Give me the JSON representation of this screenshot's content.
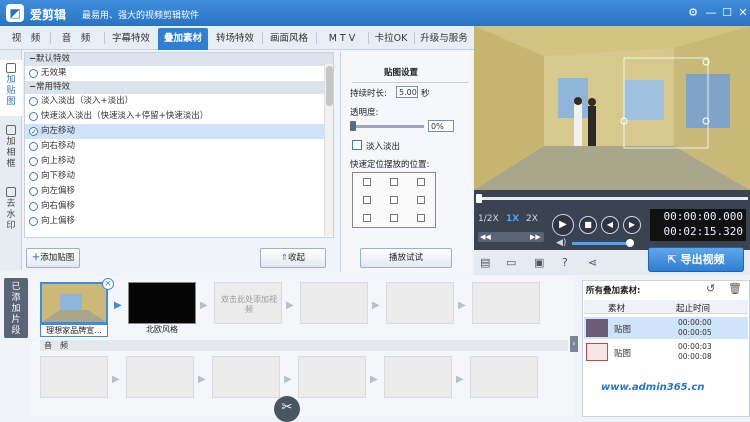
{
  "app": {
    "title": "爱剪辑",
    "slogan": "最易用、强大的视频剪辑软件",
    "window_buttons": [
      "settings-icon",
      "minimize-icon",
      "maximize-icon",
      "close-icon"
    ]
  },
  "tabs": [
    {
      "label": "视　频"
    },
    {
      "label": "音　频"
    },
    {
      "label": "字幕特效"
    },
    {
      "label": "叠加素材",
      "active": true
    },
    {
      "label": "转场特效"
    },
    {
      "label": "画面风格"
    },
    {
      "label": "M T V"
    },
    {
      "label": "卡拉OK"
    },
    {
      "label": "升级与服务"
    }
  ],
  "side_tabs": [
    {
      "label": "加贴图",
      "active": true
    },
    {
      "label": "加相框"
    },
    {
      "label": "去水印"
    }
  ],
  "effects": {
    "group_default": "默认特效",
    "no_effect": "无效果",
    "group_common": "常用特效",
    "items": [
      "淡入淡出（淡入+淡出）",
      "快速淡入淡出（快速淡入+停留+快速淡出）",
      "向左移动",
      "向右移动",
      "向上移动",
      "向下移动",
      "向左偏移",
      "向右偏移",
      "向上偏移"
    ],
    "selected_index": 2
  },
  "buttons": {
    "add_sticker": "添加贴图",
    "collapse": "收起",
    "play_test": "播放试试"
  },
  "sticker_settings": {
    "title": "贴图设置",
    "duration_label": "持续时长:",
    "duration_value": "5.00",
    "duration_unit": "秒",
    "opacity_label": "透明度:",
    "opacity_value": "0%",
    "fade_label": "淡入淡出",
    "position_label": "快速定位摆放的位置:"
  },
  "player": {
    "speeds": [
      "1/2X",
      "1X",
      "2X"
    ],
    "active_speed": "1X",
    "current_time": "00:00:00.000",
    "total_time": "00:02:15.320",
    "progress": 0
  },
  "export_button": "导出视频",
  "timeline": {
    "side_label": "已添加片段",
    "clips": [
      {
        "caption": "理想家品牌宣..."
      },
      {
        "caption": "北欧风格"
      },
      {
        "caption": "",
        "placeholder": "双击此处添加视频"
      }
    ],
    "audio_label": "音　频"
  },
  "overlay_panel": {
    "title": "所有叠加素材:",
    "col_material": "素材",
    "col_time": "起止时间",
    "rows": [
      {
        "name": "贴图",
        "start": "00:00:00",
        "end": "00:00:05",
        "selected": true
      },
      {
        "name": "贴图",
        "start": "00:00:03",
        "end": "00:00:08",
        "selected": false
      }
    ]
  },
  "watermark": "www.admin365.cn"
}
